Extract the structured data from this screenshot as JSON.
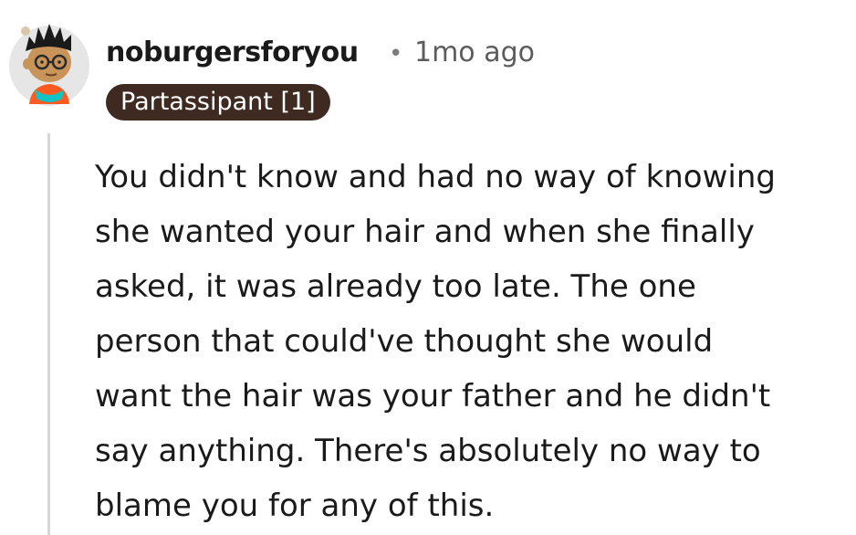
{
  "comment": {
    "author": "noburgersforyou",
    "separator": "•",
    "timestamp": "1mo ago",
    "flair": "Partassipant [1]",
    "body_lines": [
      "You didn't know and had no way of knowing",
      "she wanted your hair and when she finally",
      "asked, it was already too late. The one",
      "person that could've thought she would",
      "want the hair was your father and he didn't",
      "say anything. There's absolutely no way to",
      "blame you for any of this."
    ]
  },
  "colors": {
    "flair_bg": "#3f2a22",
    "flair_text": "#ffffff",
    "avatar_bg": "#e6e6e6",
    "avatar_shirt": "#ff5a1f",
    "avatar_collar": "#13c2c2",
    "avatar_skin": "#c8945a"
  },
  "icons": {
    "avatar": "user-avatar-icon"
  }
}
